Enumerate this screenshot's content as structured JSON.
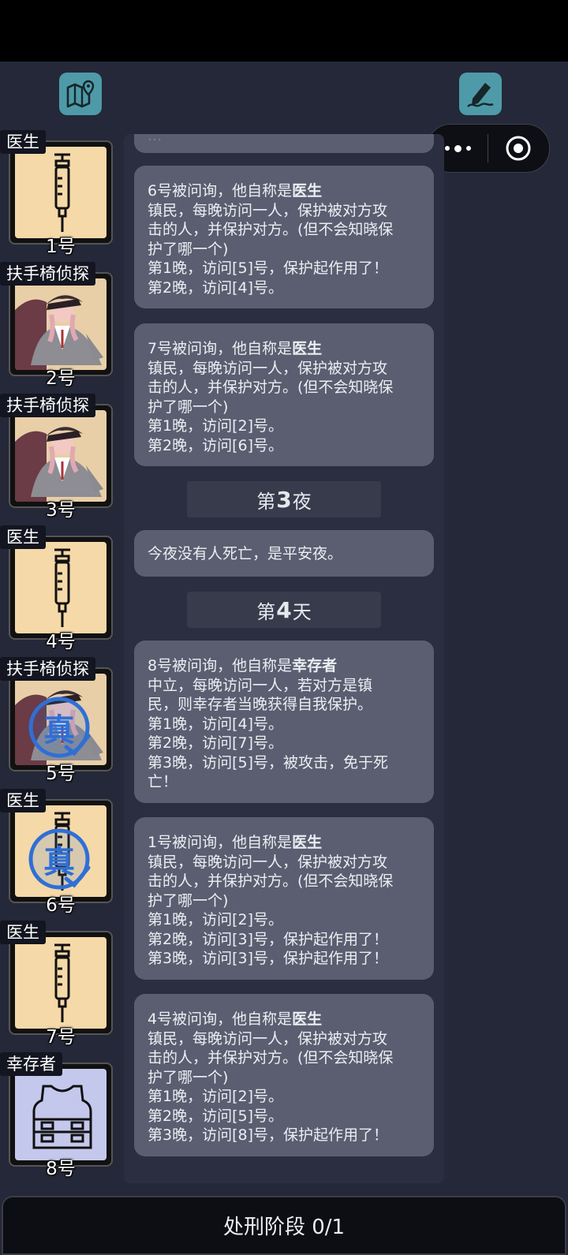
{
  "toolbar": {
    "map_icon": "map-pin-icon",
    "note_icon": "pen-note-icon"
  },
  "capsule": {
    "more_icon": "more-dots-icon",
    "close_icon": "target-circle-icon"
  },
  "players": [
    {
      "role": "医生",
      "num": "1号",
      "portrait": "syringe",
      "verified": false
    },
    {
      "role": "扶手椅侦探",
      "num": "2号",
      "portrait": "detective",
      "verified": false
    },
    {
      "role": "扶手椅侦探",
      "num": "3号",
      "portrait": "detective",
      "verified": false
    },
    {
      "role": "医生",
      "num": "4号",
      "portrait": "syringe",
      "verified": false
    },
    {
      "role": "扶手椅侦探",
      "num": "5号",
      "portrait": "detective",
      "verified": true
    },
    {
      "role": "医生",
      "num": "6号",
      "portrait": "syringe",
      "verified": true
    },
    {
      "role": "医生",
      "num": "7号",
      "portrait": "syringe",
      "verified": false
    },
    {
      "role": "幸存者",
      "num": "8号",
      "portrait": "vest",
      "verified": false
    }
  ],
  "badge_text": "真",
  "feed": {
    "top_cut": "...",
    "messages": [
      {
        "intro": "6号被问询，他自称是",
        "role": "医生",
        "lines": [
          "镇民，每晚访问一人，保护被对方攻",
          "击的人，并保护对方。(但不会知晓保",
          "护了哪一个)",
          "第1晚，访问[5]号，保护起作用了！",
          "第2晚，访问[4]号。"
        ]
      },
      {
        "intro": "7号被问询，他自称是",
        "role": "医生",
        "lines": [
          "镇民，每晚访问一人，保护被对方攻",
          "击的人，并保护对方。(但不会知晓保",
          "护了哪一个)",
          "第1晚，访问[2]号。",
          "第2晚，访问[6]号。"
        ]
      },
      {
        "intro": "今夜没有人死亡，是平安夜。",
        "role": "",
        "lines": []
      },
      {
        "intro": "8号被问询，他自称是",
        "role": "幸存者",
        "lines": [
          "中立，每晚访问一人，若对方是镇",
          "民，则幸存者当晚获得自我保护。",
          "第1晚，访问[4]号。",
          "第2晚，访问[7]号。",
          "第3晚，访问[5]号，被攻击，免于死",
          "亡！"
        ]
      },
      {
        "intro": "1号被问询，他自称是",
        "role": "医生",
        "lines": [
          "镇民，每晚访问一人，保护被对方攻",
          "击的人，并保护对方。(但不会知晓保",
          "护了哪一个)",
          "第1晚，访问[2]号。",
          "第2晚，访问[3]号，保护起作用了！",
          "第3晚，访问[3]号，保护起作用了！"
        ]
      },
      {
        "intro": "4号被问询，他自称是",
        "role": "医生",
        "lines": [
          "镇民，每晚访问一人，保护被对方攻",
          "击的人，并保护对方。(但不会知晓保",
          "护了哪一个)",
          "第1晚，访问[2]号。",
          "第2晚，访问[5]号。",
          "第3晚，访问[8]号，保护起作用了！"
        ]
      }
    ],
    "dividers": [
      {
        "pre": "第",
        "n": "3",
        "post": "夜"
      },
      {
        "pre": "第",
        "n": "4",
        "post": "天"
      }
    ]
  },
  "bottom": {
    "label": "处刑阶段 0/1"
  },
  "colors": {
    "background": "#242839",
    "bubble": "#5b5e70",
    "accent": "#4f9aa8",
    "badge": "#2f6fd6"
  }
}
